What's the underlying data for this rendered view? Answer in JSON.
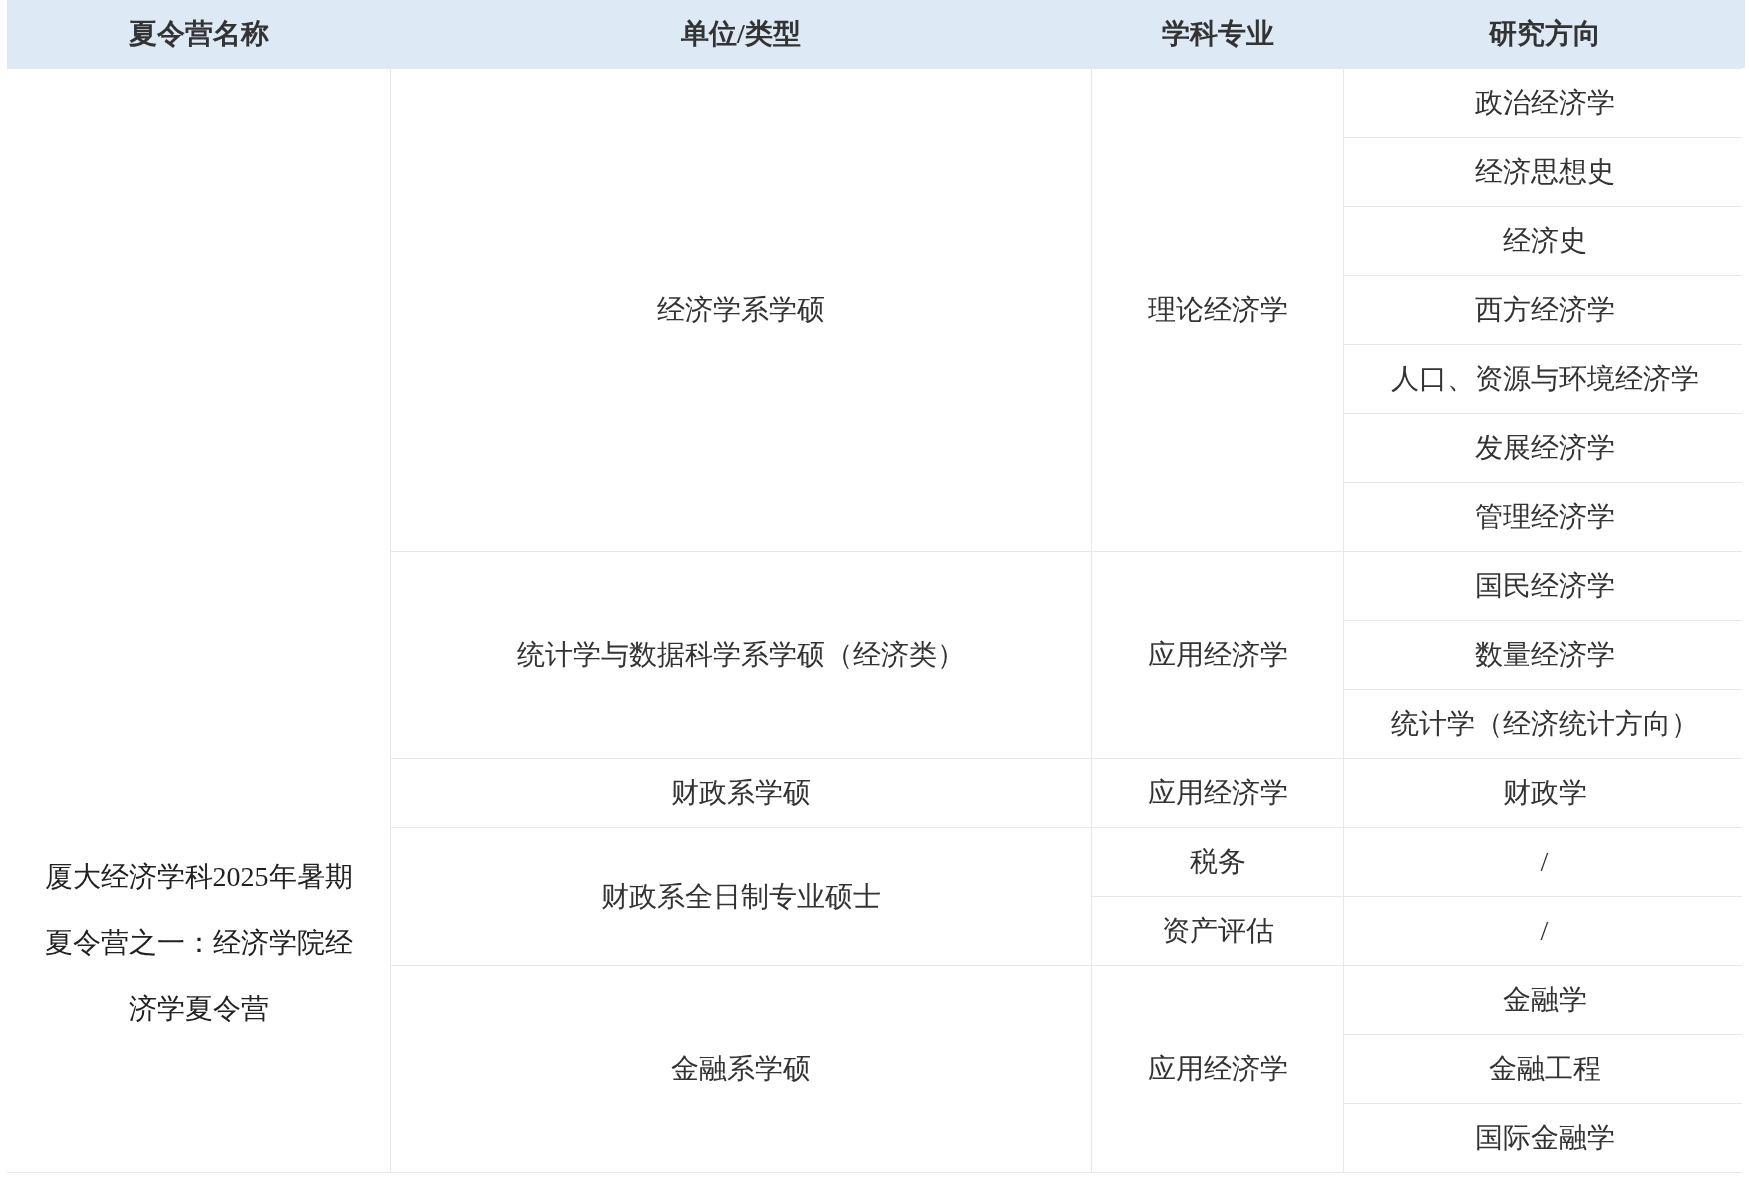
{
  "table": {
    "columns": [
      "夏令营名称",
      "单位/类型",
      "学科专业",
      "研究方向"
    ],
    "camp_name": "厦大经济学科2025年暑期夏令营之一：经济学院经济学夏令营",
    "units": [
      {
        "name": "经济学系学硕",
        "majors": [
          {
            "name": "理论经济学",
            "directions": [
              "政治经济学",
              "经济思想史",
              "经济史",
              "西方经济学",
              "人口、资源与环境经济学",
              "发展经济学",
              "管理经济学"
            ]
          }
        ]
      },
      {
        "name": "统计学与数据科学系学硕（经济类）",
        "majors": [
          {
            "name": "应用经济学",
            "directions": [
              "国民经济学",
              "数量经济学",
              "统计学（经济统计方向）"
            ]
          }
        ]
      },
      {
        "name": "财政系学硕",
        "majors": [
          {
            "name": "应用经济学",
            "directions": [
              "财政学"
            ]
          }
        ]
      },
      {
        "name": "财政系全日制专业硕士",
        "majors": [
          {
            "name": "税务",
            "directions": [
              "/"
            ]
          },
          {
            "name": "资产评估",
            "directions": [
              "/"
            ]
          }
        ]
      },
      {
        "name": "金融系学硕",
        "majors": [
          {
            "name": "应用经济学",
            "directions": [
              "金融学",
              "金融工程",
              "国际金融学"
            ]
          }
        ]
      }
    ]
  }
}
